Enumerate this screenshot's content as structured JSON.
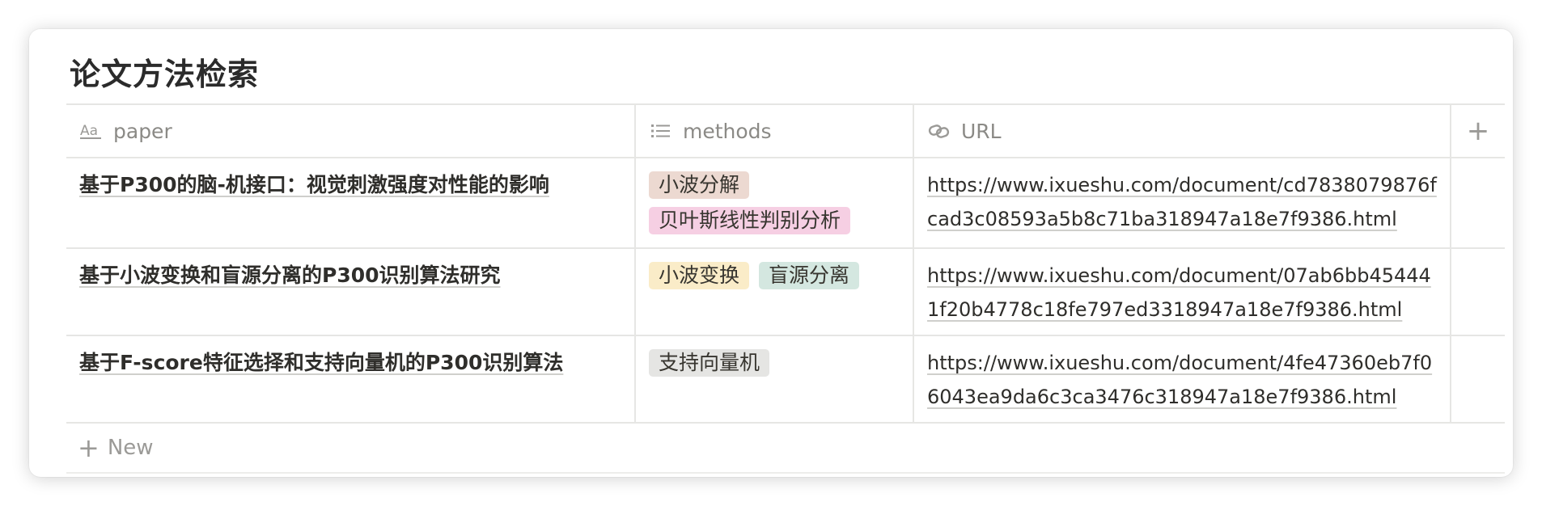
{
  "database": {
    "title": "论文方法检索"
  },
  "columns": [
    {
      "label": "paper",
      "icon": "title-text-icon"
    },
    {
      "label": "methods",
      "icon": "list-icon"
    },
    {
      "label": "URL",
      "icon": "link-icon"
    }
  ],
  "add_column_label": "+",
  "rows": [
    {
      "paper": "基于P300的脑-机接口：视觉刺激强度对性能的影响",
      "methods": [
        {
          "label": "小波分解",
          "color": "#ecd9d1"
        },
        {
          "label": "贝叶斯线性判别分析",
          "color": "#f6cfe3"
        }
      ],
      "url": "https://www.ixueshu.com/document/cd7838079876fcad3c08593a5b8c71ba318947a18e7f9386.html"
    },
    {
      "paper": "基于小波变换和盲源分离的P300识别算法研究",
      "methods": [
        {
          "label": "小波变换",
          "color": "#faecc8"
        },
        {
          "label": "盲源分离",
          "color": "#d4e7e0"
        }
      ],
      "url": "https://www.ixueshu.com/document/07ab6bb454441f20b4778c18fe797ed3318947a18e7f9386.html"
    },
    {
      "paper": "基于F-score特征选择和支持向量机的P300识别算法",
      "methods": [
        {
          "label": "支持向量机",
          "color": "#e5e5e3"
        }
      ],
      "url": "https://www.ixueshu.com/document/4fe47360eb7f06043ea9da6c3ca3476c318947a18e7f9386.html"
    }
  ],
  "new_row_label": "New"
}
